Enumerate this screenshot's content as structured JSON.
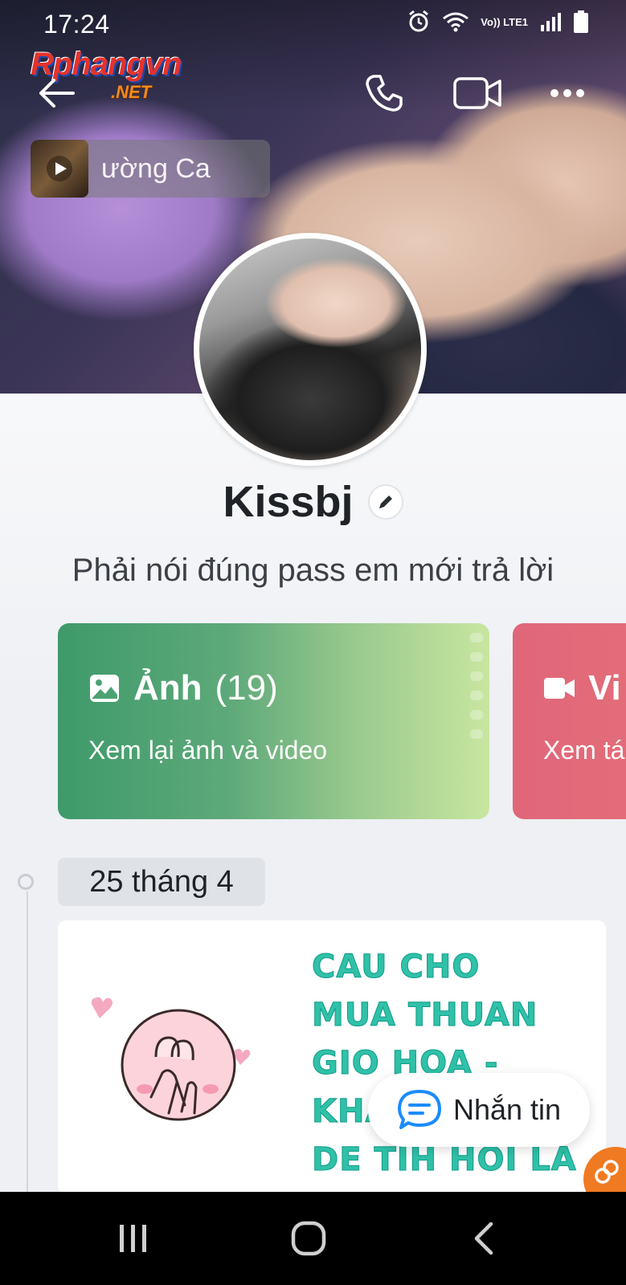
{
  "status_bar": {
    "time": "17:24",
    "network": "Vo)) LTE1"
  },
  "watermark": {
    "name": "Rphangvn",
    "suffix": ".NET"
  },
  "header": {
    "music_text": "ường      Ca"
  },
  "profile": {
    "name": "Kissbj",
    "status": "Phải nói đúng pass em mới trả lời"
  },
  "cards": {
    "photos": {
      "title": "Ảnh",
      "count": "(19)",
      "subtitle": "Xem lại ảnh và video"
    },
    "videos": {
      "title": "Vi",
      "subtitle": "Xem tá"
    }
  },
  "timeline": {
    "date": "25 tháng 4",
    "post_text_lines": [
      "Cau cho",
      "mua thuan",
      "gio hoa -",
      "khá",
      "de tih hoi la"
    ]
  },
  "actions": {
    "message_label": "Nhắn tin"
  },
  "icons": {
    "back": "arrow-left-icon",
    "call": "phone-icon",
    "video": "video-camera-icon",
    "more": "more-dots-icon",
    "play": "play-icon",
    "edit": "pencil-icon",
    "image": "image-icon",
    "message": "chat-bubble-icon"
  },
  "colors": {
    "photos_card": "#3e9a6a",
    "videos_card": "#e0667a",
    "post_text": "#30c1a8",
    "floating_button": "#f07a22"
  }
}
